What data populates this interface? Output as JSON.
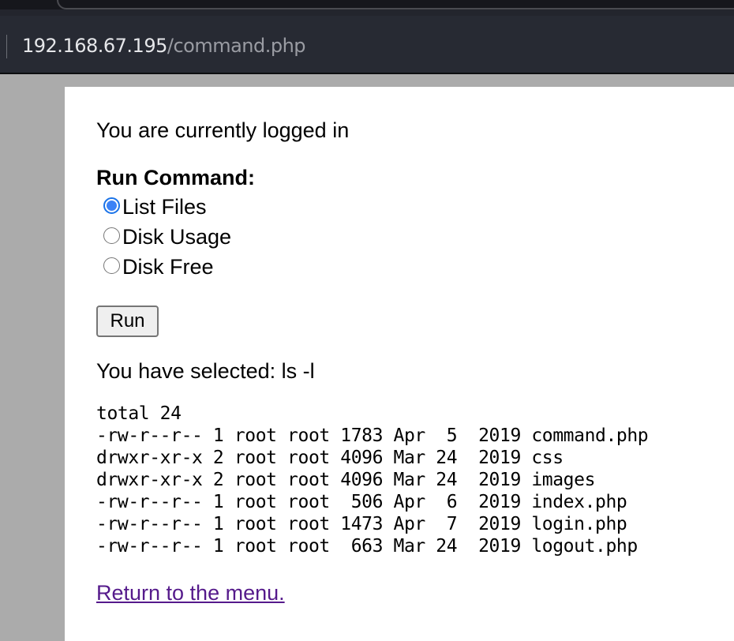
{
  "browser": {
    "url_host": "192.168.67.195",
    "url_path": "/command.php"
  },
  "page": {
    "status_text": "You are currently logged in",
    "run_command_label": "Run Command:",
    "options": [
      {
        "label": "List Files",
        "checked": true
      },
      {
        "label": "Disk Usage",
        "checked": false
      },
      {
        "label": "Disk Free",
        "checked": false
      }
    ],
    "run_button_label": "Run",
    "selected_text": "You have selected: ls -l",
    "output_lines": [
      "total 24",
      "-rw-r--r-- 1 root root 1783 Apr  5  2019 command.php",
      "drwxr-xr-x 2 root root 4096 Mar 24  2019 css",
      "drwxr-xr-x 2 root root 4096 Mar 24  2019 images",
      "-rw-r--r-- 1 root root  506 Apr  6  2019 index.php",
      "-rw-r--r-- 1 root root 1473 Apr  7  2019 login.php",
      "-rw-r--r-- 1 root root  663 Mar 24  2019 logout.php"
    ],
    "return_link": "Return to the menu."
  },
  "colors": {
    "link_visited": "#551a8b",
    "radio_accent": "#3b82f6",
    "toolbar_bg": "#272a33",
    "page_bg": "#ababab"
  }
}
